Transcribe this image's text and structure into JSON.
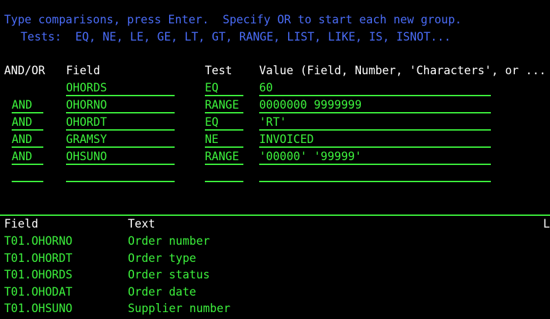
{
  "instructions": {
    "line1": "Type comparisons, press Enter.  Specify OR to start each new group.",
    "line2": "Tests:  EQ, NE, LE, GE, LT, GT, RANGE, LIST, LIKE, IS, ISNOT..."
  },
  "headers": {
    "andor": "AND/OR",
    "field": "Field",
    "test": "Test",
    "value": "Value (Field, Number, 'Characters', or ..."
  },
  "rows": [
    {
      "andor": "",
      "field": "OHORDS",
      "test": "EQ",
      "value": "60"
    },
    {
      "andor": "AND",
      "field": "OHORNO",
      "test": "RANGE",
      "value": "0000000 9999999"
    },
    {
      "andor": "AND",
      "field": "OHORDT",
      "test": "EQ",
      "value": "'RT'"
    },
    {
      "andor": "AND",
      "field": "GRAMSY",
      "test": "NE",
      "value": "INVOICED"
    },
    {
      "andor": "AND",
      "field": "OHSUNO",
      "test": "RANGE",
      "value": "'00000' '99999'"
    },
    {
      "andor": "",
      "field": "",
      "test": "",
      "value": ""
    }
  ],
  "list_headers": {
    "field": "Field",
    "text": "Text",
    "len": "L"
  },
  "list": [
    {
      "field": "T01.OHORNO",
      "text": "Order number"
    },
    {
      "field": "T01.OHORDT",
      "text": "Order type"
    },
    {
      "field": "T01.OHORDS",
      "text": "Order status"
    },
    {
      "field": "T01.OHODAT",
      "text": "Order date"
    },
    {
      "field": "T01.OHSUNO",
      "text": "Supplier number"
    }
  ],
  "colors": {
    "background": "#000000",
    "blue": "#4a6cf7",
    "green": "#3cf03c",
    "white": "#ffffff"
  }
}
